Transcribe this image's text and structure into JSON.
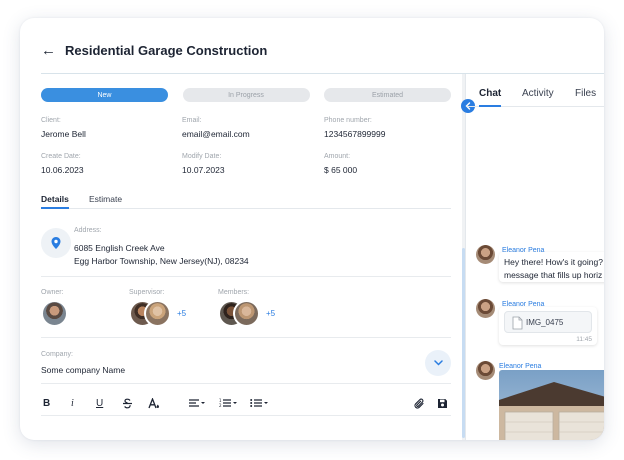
{
  "header": {
    "back_symbol": "←",
    "title": "Residential Garage Construction"
  },
  "statuses": [
    {
      "label": "New",
      "active": true
    },
    {
      "label": "In Progress",
      "active": false
    },
    {
      "label": "Estimated",
      "active": false
    }
  ],
  "info": {
    "client": {
      "label": "Client:",
      "value": "Jerome Bell"
    },
    "email": {
      "label": "Email:",
      "value": "email@email.com"
    },
    "phone": {
      "label": "Phone number:",
      "value": "1234567899999"
    },
    "create_date": {
      "label": "Create Date:",
      "value": "10.06.2023"
    },
    "modify_date": {
      "label": "Modify Date:",
      "value": "10.07.2023"
    },
    "amount": {
      "label": "Amount:",
      "value": "$ 65 000"
    }
  },
  "subtabs": {
    "details": "Details",
    "estimate": "Estimate"
  },
  "address": {
    "label": "Address:",
    "line1": "6085 English Creek Ave",
    "line2": "Egg Harbor Township, New Jersey(NJ), 08234"
  },
  "people": {
    "owner_label": "Owner:",
    "supervisor_label": "Supervisor:",
    "supervisor_more": "+5",
    "members_label": "Members:",
    "members_more": "+5"
  },
  "company": {
    "label": "Company:",
    "value": "Some company Name"
  },
  "toolbar": {
    "bold": "B",
    "italic": "i",
    "underline": "U",
    "icons": [
      "strikethrough-icon",
      "text-color-icon",
      "align-icon",
      "numbered-list-icon",
      "bullet-list-icon",
      "attach-icon",
      "save-icon"
    ]
  },
  "right_tabs": {
    "chat": "Chat",
    "activity": "Activity",
    "files": "Files"
  },
  "messages": [
    {
      "author": "Eleanor Pena",
      "text_line1": "Hey there! How's it going?",
      "text_line2": "message that fills up horiz"
    },
    {
      "author": "Eleanor Pena",
      "file": "IMG_0475",
      "time": "11:45"
    },
    {
      "author": "Eleanor Pena",
      "image": "garage-photo"
    }
  ],
  "colors": {
    "accent": "#2a7de1",
    "status_active": "#3a8fe0",
    "status_inactive": "#e6e8eb"
  }
}
